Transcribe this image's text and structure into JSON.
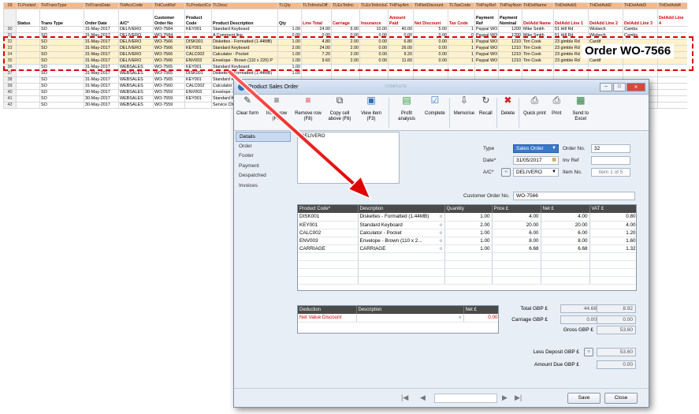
{
  "sheet": {
    "header_cells": [
      {
        "t": "29",
        "red": false
      },
      {
        "t": "TLPosted",
        "red": false
      },
      {
        "t": "THTransType",
        "red": false
      },
      {
        "t": "THTransDate",
        "red": false
      },
      {
        "t": "THAccCode",
        "red": false
      },
      {
        "t": "THCustRef",
        "red": false
      },
      {
        "t": "TLProductCode",
        "red": false
      },
      {
        "t": "TLDesc",
        "red": false
      },
      {
        "t": "TLQty",
        "red": false
      },
      {
        "t": "TLTotIncluOff",
        "red": false
      },
      {
        "t": "TLExTotInc",
        "red": false
      },
      {
        "t": "TLExTotIncluOff",
        "red": false
      },
      {
        "t": "THPayAm",
        "red": false
      },
      {
        "t": "THNetDiscount",
        "red": false
      },
      {
        "t": "TLTaxCode",
        "red": false
      },
      {
        "t": "THPayRef",
        "red": false
      },
      {
        "t": "THPayNom",
        "red": false
      },
      {
        "t": "THDelName",
        "red": false
      },
      {
        "t": "THDelAdd1",
        "red": false
      },
      {
        "t": "THDelAdd2",
        "red": false
      },
      {
        "t": "THDelAdd3",
        "red": false
      },
      {
        "t": "THDelAdd4",
        "red": false
      }
    ],
    "sub_cells": [
      {
        "t": "",
        "red": false
      },
      {
        "t": "Status",
        "red": false
      },
      {
        "t": "Trans Type",
        "red": false
      },
      {
        "t": "Order Date",
        "red": false
      },
      {
        "t": "A/C*",
        "red": false
      },
      {
        "t": "Customer Order No",
        "red": false
      },
      {
        "t": "Product Code",
        "red": false
      },
      {
        "t": "Product Description",
        "red": false
      },
      {
        "t": "Qty",
        "red": false
      },
      {
        "t": "Line Total",
        "red": true
      },
      {
        "t": "Carriage",
        "red": true
      },
      {
        "t": "Insurance",
        "red": true
      },
      {
        "t": "Amount Paid",
        "red": true
      },
      {
        "t": "Net Discount",
        "red": true
      },
      {
        "t": "Tax Code",
        "red": true
      },
      {
        "t": "Payment Ref",
        "red": false
      },
      {
        "t": "Payment Nominal",
        "red": false
      },
      {
        "t": "DelAdd Name",
        "red": true
      },
      {
        "t": "DelAdd Line 1",
        "red": true
      },
      {
        "t": "DelAdd Line 2",
        "red": true
      },
      {
        "t": "DelAdd Line 3",
        "red": true
      },
      {
        "t": "DelAdd Line 4",
        "red": true
      }
    ],
    "rows": [
      {
        "hl": false,
        "c": [
          "30",
          "",
          "SO",
          "31-May-2017",
          "DELIVERO",
          "WO-7584",
          "KEY001",
          "Standard Keyboard",
          "1.00",
          "24.00",
          "6.00",
          "10.00",
          "40.00",
          "5.00",
          "1",
          "Paypal WO",
          "1200",
          "Mike Smith",
          "51 Hill Rd",
          "Wisbech",
          "Cambs",
          ""
        ]
      },
      {
        "hl": false,
        "c": [
          "31",
          "",
          "SO",
          "31-May-2017",
          "DELIVERO",
          "WO-7584",
          "",
          "A Comment line",
          "0.00",
          "0.00",
          "0.00",
          "0.00",
          "0.00",
          "0.00",
          "0",
          "Paypal WO",
          "1200",
          "Mike Smith",
          "51 Hill Rd",
          "Wisbech",
          "Cambs",
          ""
        ]
      },
      {
        "hl": true,
        "c": [
          "32",
          "",
          "SO",
          "31-May-2017",
          "DELIVERO",
          "WO-7566",
          "DISK001",
          "Diskettes - Formatted (1.44MB)",
          "1.00",
          "4.80",
          "2.00",
          "0.00",
          "6.80",
          "0.00",
          "1",
          "Paypal WO",
          "1210",
          "Tim Cook",
          "23 gimble Rd",
          "Cardif",
          "",
          ""
        ]
      },
      {
        "hl": true,
        "c": [
          "33",
          "",
          "SO",
          "31-May-2017",
          "DELIVERO",
          "WO-7566",
          "KEY001",
          "Standard Keyboard",
          "2.00",
          "24.00",
          "2.00",
          "0.00",
          "26.00",
          "0.00",
          "1",
          "Paypal WO",
          "1210",
          "Tim Cook",
          "23 gimble Rd",
          "Cardif",
          "",
          ""
        ]
      },
      {
        "hl": true,
        "c": [
          "34",
          "",
          "SO",
          "31-May-2017",
          "DELIVERO",
          "WO-7566",
          "CALC002",
          "Calculator - Pocket",
          "1.00",
          "7.20",
          "2.00",
          "0.00",
          "9.20",
          "0.00",
          "1",
          "Paypal WO",
          "1210",
          "Tim Cook",
          "23 gimble Rd",
          "Cardif",
          "",
          ""
        ]
      },
      {
        "hl": true,
        "c": [
          "35",
          "",
          "SO",
          "31-May-2017",
          "DELIVERO",
          "WO-7566",
          "ENV003",
          "Envelope - Brown (110 x 220) P",
          "1.00",
          "9.60",
          "2.00",
          "0.00",
          "11.60",
          "0.00",
          "1",
          "Paypal WO",
          "1210",
          "Tim Cook",
          "23 gimble Rd",
          "Cardif",
          "",
          ""
        ]
      },
      {
        "hl": false,
        "c": [
          "36",
          "",
          "SO",
          "31-May-2017",
          "WEBSALES",
          "WO-7565",
          "KEY001",
          "Standard Keyboard",
          "1.00",
          "",
          "",
          "",
          "",
          "",
          "",
          "",
          "",
          "",
          "",
          "",
          "",
          ""
        ]
      },
      {
        "hl": false,
        "c": [
          "37",
          "",
          "SO",
          "31-May-2017",
          "WEBSALES",
          "WO-7565",
          "DISK001",
          "Diskettes - Formatted (1.44MB)",
          "1.00",
          "",
          "",
          "",
          "",
          "",
          "",
          "",
          "",
          "",
          "",
          "",
          "",
          ""
        ]
      },
      {
        "hl": false,
        "c": [
          "38",
          "",
          "SO",
          "31-May-2017",
          "WEBSALES",
          "WO-7565",
          "KEY001",
          "Standard Keyb",
          "",
          "",
          "",
          "",
          "",
          "",
          "",
          "",
          "",
          "",
          "",
          "",
          "",
          ""
        ]
      },
      {
        "hl": false,
        "c": [
          "39",
          "",
          "SO",
          "31-May-2017",
          "WEBSALES",
          "WO-7560",
          "CALC002",
          "Calculator - Po",
          "",
          "",
          "",
          "",
          "",
          "",
          "",
          "",
          "",
          "",
          "",
          "",
          "",
          ""
        ]
      },
      {
        "hl": false,
        "c": [
          "40",
          "",
          "SO",
          "30-May-2017",
          "WEBSALES",
          "WO-7559",
          "ENV003",
          "Envelope - Bro",
          "",
          "",
          "",
          "",
          "",
          "",
          "",
          "",
          "",
          "",
          "",
          "",
          "",
          ""
        ]
      },
      {
        "hl": false,
        "c": [
          "41",
          "",
          "SO",
          "30-May-2017",
          "WEBSALES",
          "WO-7559",
          "KEY001",
          "Standard Keyb",
          "",
          "",
          "",
          "",
          "",
          "",
          "",
          "",
          "",
          "",
          "",
          "",
          "",
          ""
        ]
      },
      {
        "hl": false,
        "c": [
          "42",
          "",
          "SO",
          "30-May-2017",
          "WEBSALES",
          "WO-7559",
          "",
          "Service Charge",
          "",
          "",
          "",
          "",
          "",
          "",
          "",
          "",
          "",
          "",
          "",
          "",
          "",
          ""
        ]
      }
    ],
    "right_extra": "Cambs",
    "callout": "Order WO-7566"
  },
  "window": {
    "title": "Product Sales Order",
    "title_status": "COMPLETE",
    "toolbar": [
      {
        "label": "Clear form",
        "icon": "clear-form-icon"
      },
      {
        "label": "Insert row (F7)",
        "icon": "insert-row-icon"
      },
      {
        "label": "Remove row (F8)",
        "icon": "remove-row-icon"
      },
      {
        "label": "Copy cell above (F6)",
        "icon": "copy-cell-icon"
      },
      {
        "label": "View item (F3)",
        "icon": "view-item-icon"
      },
      {
        "label": "Profit analysis",
        "icon": "profit-analysis-icon"
      },
      {
        "label": "Complete",
        "icon": "complete-icon"
      },
      {
        "label": "Memorise",
        "icon": "memorise-icon"
      },
      {
        "label": "Recall",
        "icon": "recall-icon"
      },
      {
        "label": "Delete",
        "icon": "delete-icon"
      },
      {
        "label": "Quick print",
        "icon": "quick-print-icon"
      },
      {
        "label": "Print",
        "icon": "print-icon"
      },
      {
        "label": "Send to Excel",
        "icon": "excel-icon"
      }
    ],
    "nav": [
      "Details",
      "Order",
      "Footer",
      "Payment",
      "Despatched",
      "Invoices"
    ],
    "address": "DELIVERO",
    "type_label": "Type",
    "type_value": "Sales Order",
    "order_no_label": "Order No.",
    "order_no": "32",
    "date_label": "Date*",
    "date_value": "31/05/2017",
    "inv_ref_label": "Inv Ref",
    "inv_ref": "",
    "ac_label": "A/C*",
    "ac_value": "DELIVERO",
    "item_no_label": "Item No.",
    "item_no": "Item 1 of 5",
    "cust_order_label": "Customer Order No.",
    "cust_order": "WO-7566",
    "lines_headers": [
      "Product Code*",
      "Description",
      "Quantity",
      "Price £",
      "Net £",
      "VAT £"
    ],
    "lines": [
      {
        "code": "DISK001",
        "desc": "Diskettes - Formatted (1.44MB)",
        "qty": "1.00",
        "price": "4.00",
        "net": "4.00",
        "vat": "0.80"
      },
      {
        "code": "KEY001",
        "desc": "Standard Keyboard",
        "qty": "2.00",
        "price": "20.00",
        "net": "20.00",
        "vat": "4.00"
      },
      {
        "code": "CALC002",
        "desc": "Calculator - Pocket",
        "qty": "1.00",
        "price": "6.00",
        "net": "6.00",
        "vat": "1.20"
      },
      {
        "code": "ENV003",
        "desc": "Envelope - Brown (110 x 2...",
        "qty": "1.00",
        "price": "8.00",
        "net": "8.00",
        "vat": "1.60"
      },
      {
        "code": "CARRIAGE",
        "desc": "CARRIAGE",
        "qty": "1.00",
        "price": "6.68",
        "net": "6.68",
        "vat": "1.32"
      }
    ],
    "ded_headers": [
      "Deduction",
      "Description",
      "Net £"
    ],
    "deduction": {
      "name": "Net Value Discount",
      "desc": "",
      "net": "0.00"
    },
    "totals": {
      "total_label": "Total GBP £",
      "total_net": "44.68",
      "total_vat": "8.92",
      "carriage_label": "Carriage GBP £",
      "carriage_net": "0.00",
      "carriage_vat": "0.00",
      "gross_label": "Gross GBP £",
      "gross": "53.60",
      "deposit_label": "Less Deposit GBP £",
      "deposit": "53.60",
      "amount_due_label": "Amount Due GBP £",
      "amount_due": "0.00"
    },
    "save_label": "Save",
    "close_label": "Close"
  }
}
